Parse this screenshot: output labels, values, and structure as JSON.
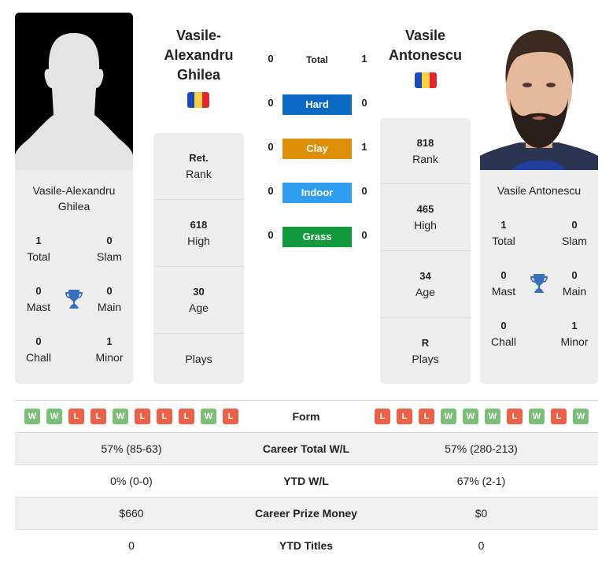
{
  "left_player": {
    "name_header": [
      "Vasile-",
      "Alexandru",
      "Ghilea"
    ],
    "card_name": [
      "Vasile-Alexandru",
      "Ghilea"
    ],
    "flag_colors": [
      "#1a49b8",
      "#f5d040",
      "#e0262f"
    ],
    "titles": {
      "total": {
        "value": "1",
        "label": "Total"
      },
      "slam": {
        "value": "0",
        "label": "Slam"
      },
      "mast": {
        "value": "0",
        "label": "Mast"
      },
      "main": {
        "value": "0",
        "label": "Main"
      },
      "chall": {
        "value": "0",
        "label": "Chall"
      },
      "minor": {
        "value": "1",
        "label": "Minor"
      }
    },
    "info": [
      {
        "value": "Ret.",
        "label": "Rank"
      },
      {
        "value": "618",
        "label": "High"
      },
      {
        "value": "30",
        "label": "Age"
      },
      {
        "value": "",
        "label": "Plays"
      }
    ],
    "form": [
      "W",
      "W",
      "L",
      "L",
      "W",
      "L",
      "L",
      "L",
      "W",
      "L"
    ]
  },
  "right_player": {
    "name_header": [
      "Vasile",
      "Antonescu"
    ],
    "card_name": [
      "Vasile Antonescu"
    ],
    "flag_colors": [
      "#1a49b8",
      "#f5d040",
      "#e0262f"
    ],
    "titles": {
      "total": {
        "value": "1",
        "label": "Total"
      },
      "slam": {
        "value": "0",
        "label": "Slam"
      },
      "mast": {
        "value": "0",
        "label": "Mast"
      },
      "main": {
        "value": "0",
        "label": "Main"
      },
      "chall": {
        "value": "0",
        "label": "Chall"
      },
      "minor": {
        "value": "1",
        "label": "Minor"
      }
    },
    "info": [
      {
        "value": "818",
        "label": "Rank"
      },
      {
        "value": "465",
        "label": "High"
      },
      {
        "value": "34",
        "label": "Age"
      },
      {
        "value": "R",
        "label": "Plays"
      }
    ],
    "form": [
      "L",
      "L",
      "L",
      "W",
      "W",
      "W",
      "L",
      "W",
      "L",
      "W"
    ]
  },
  "h2h": {
    "total": {
      "label": "Total",
      "left": "0",
      "right": "1"
    },
    "surfaces": [
      {
        "label": "Hard",
        "left": "0",
        "right": "0",
        "color": "#0a6ac3"
      },
      {
        "label": "Clay",
        "left": "0",
        "right": "1",
        "color": "#dd8f0a"
      },
      {
        "label": "Indoor",
        "left": "0",
        "right": "0",
        "color": "#2f9ef0"
      },
      {
        "label": "Grass",
        "left": "0",
        "right": "0",
        "color": "#129a3c"
      }
    ]
  },
  "comparison": {
    "form_label": "Form",
    "rows": [
      {
        "label": "Career Total W/L",
        "left": "57% (85-63)",
        "right": "57% (280-213)"
      },
      {
        "label": "YTD W/L",
        "left": "0% (0-0)",
        "right": "67% (2-1)"
      },
      {
        "label": "Career Prize Money",
        "left": "$660",
        "right": "$0"
      },
      {
        "label": "YTD Titles",
        "left": "0",
        "right": "0"
      }
    ]
  },
  "colors": {
    "win": "#7bbf7b",
    "loss": "#ec6248",
    "trophy": "#3a6fc0"
  }
}
